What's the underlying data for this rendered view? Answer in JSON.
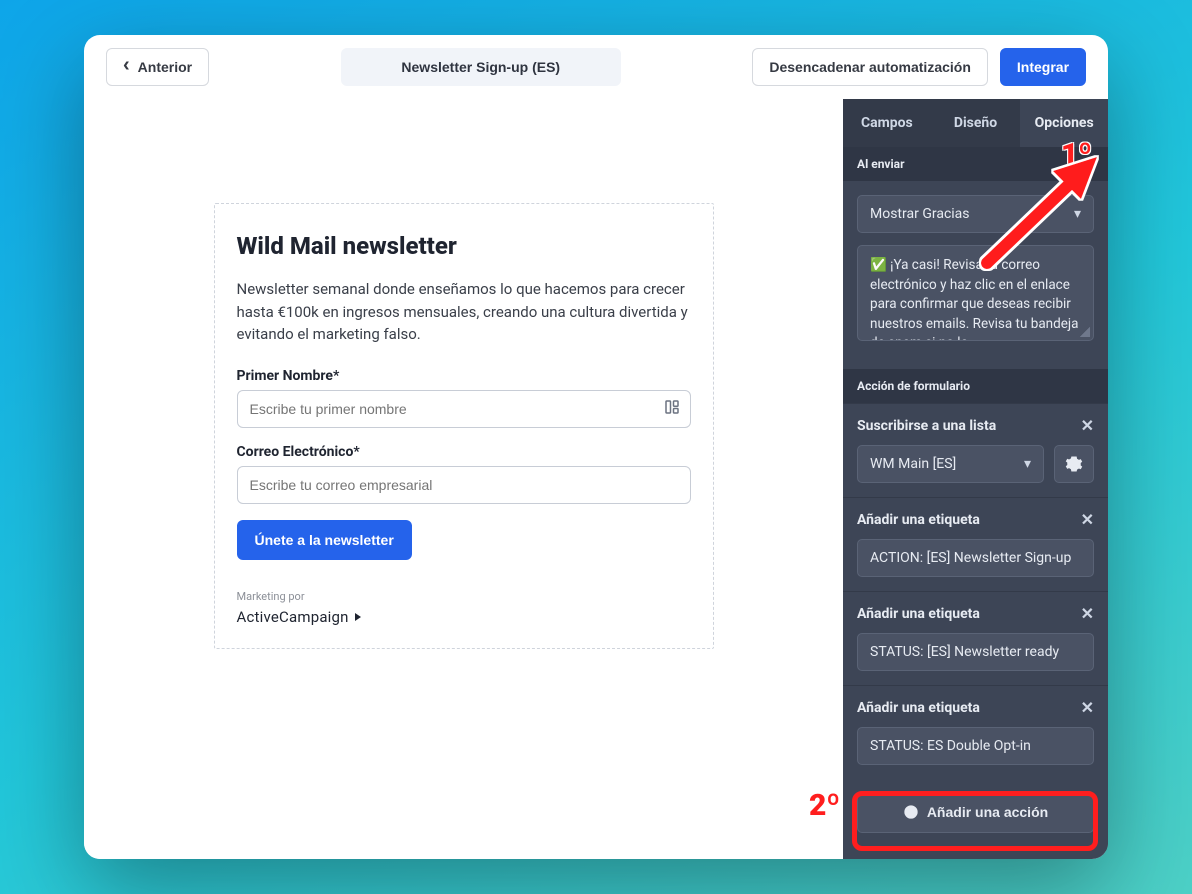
{
  "topbar": {
    "back": "Anterior",
    "title": "Newsletter Sign-up (ES)",
    "trigger": "Desencadenar automatización",
    "integrate": "Integrar"
  },
  "form": {
    "heading": "Wild Mail newsletter",
    "description": "Newsletter semanal donde enseñamos lo que hacemos para crecer hasta €100k en ingresos mensuales, creando una cultura divertida y evitando el marketing falso.",
    "first_name_label": "Primer Nombre*",
    "first_name_placeholder": "Escribe tu primer nombre",
    "email_label": "Correo Electrónico*",
    "email_placeholder": "Escribe tu correo empresarial",
    "submit": "Únete a la newsletter",
    "marketing_by": "Marketing por",
    "brand": "ActiveCampaign"
  },
  "sidebar": {
    "tabs": {
      "fields": "Campos",
      "design": "Diseño",
      "options": "Opciones"
    },
    "on_submit": {
      "header": "Al enviar",
      "select": "Mostrar Gracias",
      "thanks_text": "✅ ¡Ya casi! Revisa tu correo electrónico y haz clic en el enlace para confirmar que deseas recibir nuestros emails. Revisa tu bandeja de spam si no lo"
    },
    "form_action": {
      "header": "Acción de formulario",
      "subscribe_label": "Suscribirse a una lista",
      "subscribe_value": "WM Main [ES]",
      "tag_label": "Añadir una etiqueta",
      "tag1": "ACTION: [ES] Newsletter Sign-up",
      "tag2": "STATUS: [ES] Newsletter ready",
      "tag3": "STATUS: ES Double Opt-in",
      "add_action": "Añadir una acción"
    }
  },
  "annotations": {
    "first": "1º",
    "second": "2º"
  }
}
